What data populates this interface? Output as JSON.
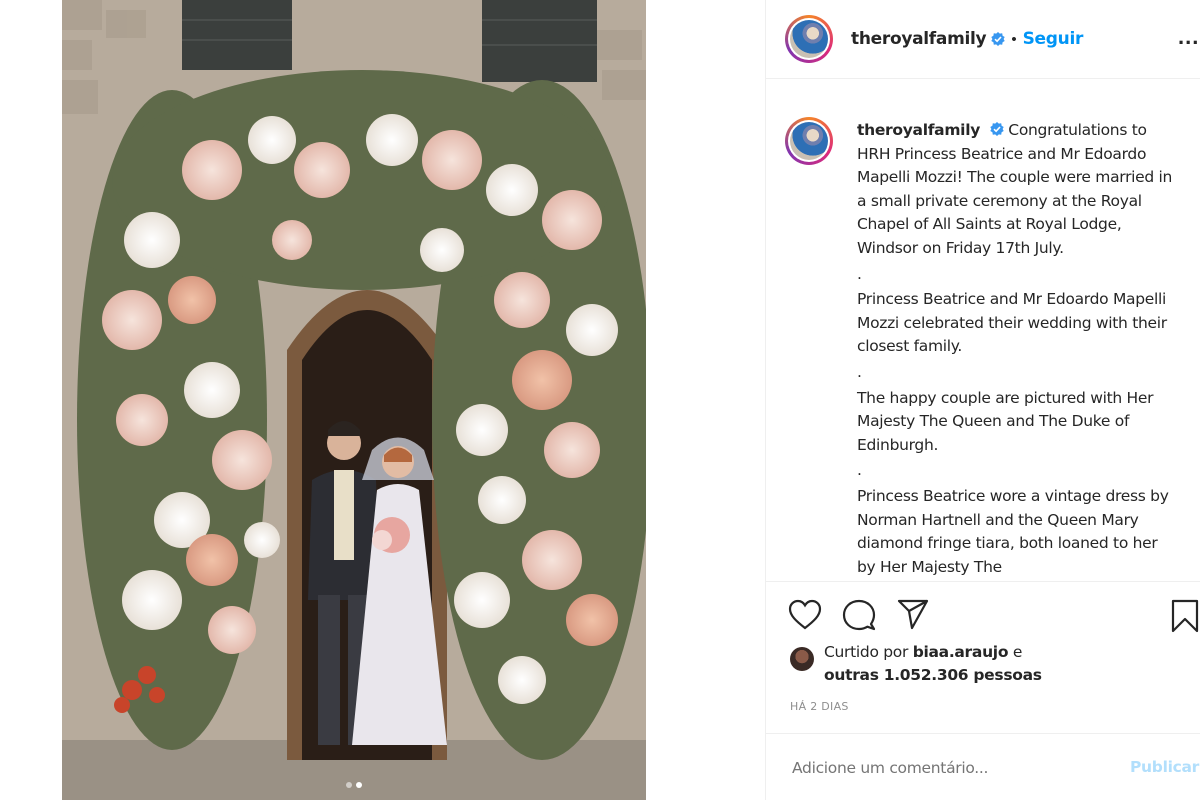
{
  "post": {
    "username": "theroyalfamily",
    "verified": true,
    "separator": "•",
    "follow_label": "Seguir",
    "more_label": "...",
    "photo_count": 2,
    "active_photo": 2
  },
  "caption": {
    "username": "theroyalfamily",
    "paragraphs": [
      "Congratulations to HRH Princess Beatrice and Mr Edoardo Mapelli Mozzi! The couple were married in a small private ceremony at the Royal Chapel of All Saints at Royal Lodge, Windsor on Friday 17th July.",
      ".",
      "Princess Beatrice and Mr Edoardo Mapelli Mozzi celebrated their wedding with their closest family.",
      ".",
      "The happy couple are pictured with Her Majesty The Queen and The Duke of Edinburgh.",
      ".",
      "Princess Beatrice wore a vintage dress by Norman Hartnell and the Queen Mary diamond fringe tiara, both loaned to her by Her Majesty The"
    ]
  },
  "likes": {
    "prefix": "Curtido por",
    "user": "biaa.araujo",
    "connector": "e",
    "others": "outras 1.052.306 pessoas"
  },
  "timestamp": "HÁ 2 DIAS",
  "comment": {
    "placeholder": "Adicione um comentário...",
    "publish_label": "Publicar"
  },
  "icons": {
    "like": "heart-icon",
    "comment": "comment-bubble-icon",
    "share": "paper-plane-icon",
    "save": "bookmark-icon",
    "verified": "verified-badge-icon"
  },
  "colors": {
    "link_blue": "#0095f6",
    "publish_disabled": "#b2dffc",
    "muted": "#8e8e8e",
    "verified": "#3897f0"
  }
}
